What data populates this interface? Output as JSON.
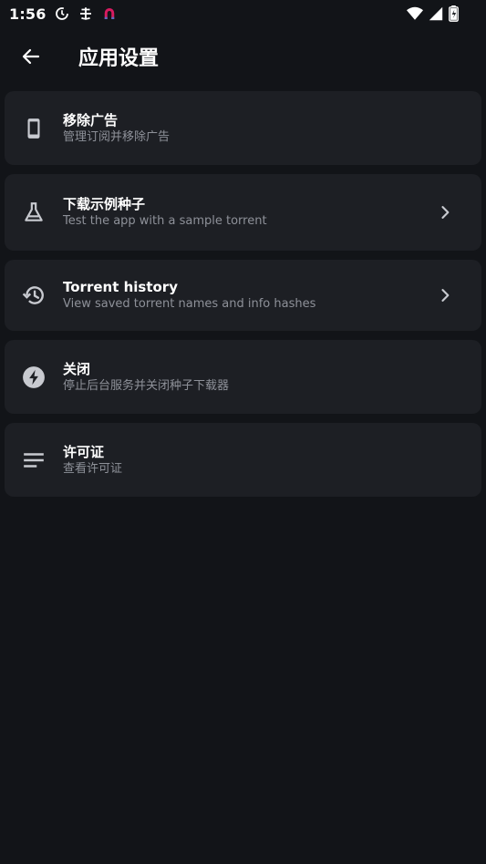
{
  "status": {
    "time": "1:56"
  },
  "header": {
    "title": "应用设置"
  },
  "items": [
    {
      "title": "移除广告",
      "subtitle": "管理订阅并移除广告",
      "icon": "phone-icon",
      "chevron": false
    },
    {
      "title": "下载示例种子",
      "subtitle": "Test the app with a sample torrent",
      "icon": "flask-icon",
      "chevron": true
    },
    {
      "title": "Torrent history",
      "subtitle": "View saved torrent names and info hashes",
      "icon": "history-icon",
      "chevron": true
    },
    {
      "title": "关闭",
      "subtitle": "停止后台服务并关闭种子下载器",
      "icon": "power-bolt-icon",
      "chevron": false
    },
    {
      "title": "许可证",
      "subtitle": "查看许可证",
      "icon": "notes-icon",
      "chevron": false
    }
  ],
  "colors": {
    "background": "#121418",
    "card": "#1d1f24",
    "subtitle": "#8e9199",
    "icon": "#c8cad0"
  }
}
